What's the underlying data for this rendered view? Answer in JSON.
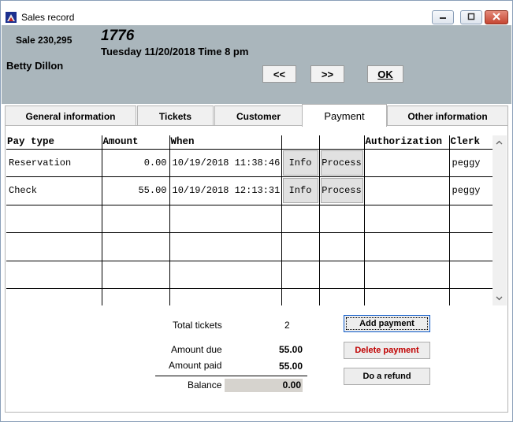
{
  "window": {
    "title": "Sales record"
  },
  "header": {
    "sale_label": "Sale 230,295",
    "sale_big_number": "1776",
    "date_time": "Tuesday 11/20/2018  Time 8 pm",
    "customer_name": "Betty Dillon",
    "nav": {
      "prev_label": "<<",
      "next_label": ">>",
      "ok_label": "OK"
    }
  },
  "tabs": [
    {
      "label": "General information",
      "active": false
    },
    {
      "label": "Tickets",
      "active": false
    },
    {
      "label": "Customer",
      "active": false
    },
    {
      "label": "Payment",
      "active": true
    },
    {
      "label": "Other information",
      "active": false
    }
  ],
  "payments": {
    "columns": [
      "Pay type",
      "Amount",
      "When",
      "",
      "",
      "Authorization",
      "Clerk"
    ],
    "rows": [
      {
        "pay_type": "Reservation",
        "amount": "0.00",
        "when": "10/19/2018 11:38:46",
        "info": "Info",
        "process": "Process",
        "authorization": "",
        "clerk": "peggy"
      },
      {
        "pay_type": "Check",
        "amount": "55.00",
        "when": "10/19/2018 12:13:31",
        "info": "Info",
        "process": "Process",
        "authorization": "",
        "clerk": "peggy"
      }
    ]
  },
  "summary": {
    "total_tickets_label": "Total tickets",
    "total_tickets_value": "2",
    "amount_due_label": "Amount due",
    "amount_due_value": "55.00",
    "amount_paid_label": "Amount paid",
    "amount_paid_value": "55.00",
    "balance_label": "Balance",
    "balance_value": "0.00"
  },
  "actions": {
    "add_payment_label": "Add payment",
    "delete_payment_label": "Delete payment",
    "refund_label": "Do a refund"
  },
  "colors": {
    "header_bg": "#aab6bc",
    "delete_text": "#c00000",
    "balance_bg": "#d6d3ce"
  },
  "icons": {
    "app": "theater-app-icon",
    "minimize": "minimize-icon",
    "maximize": "maximize-icon",
    "close": "close-icon"
  }
}
